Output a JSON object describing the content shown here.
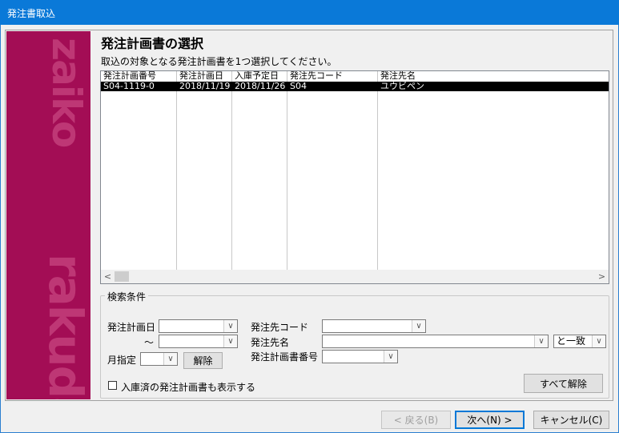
{
  "window": {
    "title": "発注書取込"
  },
  "brand": {
    "word_top": "zaiko",
    "word_bottom": "rakuda"
  },
  "page": {
    "heading": "発注計画書の選択",
    "instruction": "取込の対象となる発注計画書を1つ選択してください。"
  },
  "table": {
    "columns": [
      "発注計画番号",
      "発注計画日",
      "入庫予定日",
      "発注先コード",
      "発注先名"
    ],
    "rows": [
      [
        "S04-1119-0",
        "2018/11/19",
        "2018/11/26",
        "S04",
        "ユウビペン"
      ]
    ],
    "scroll_left": "<",
    "scroll_right": ">"
  },
  "search": {
    "group_label": "検索条件",
    "plan_date_label": "発注計画日",
    "range_tilde": "～",
    "month_label": "月指定",
    "clear_label": "解除",
    "supplier_code_label": "発注先コード",
    "supplier_name_label": "発注先名",
    "plan_number_label": "発注計画書番号",
    "match_value": "と一致",
    "include_received_label": "入庫済の発注計画書も表示する",
    "clear_all_label": "すべて解除"
  },
  "footer": {
    "back_label": "< 戻る(B)",
    "next_label": "次へ(N) >",
    "cancel_label": "キャンセル(C)"
  }
}
